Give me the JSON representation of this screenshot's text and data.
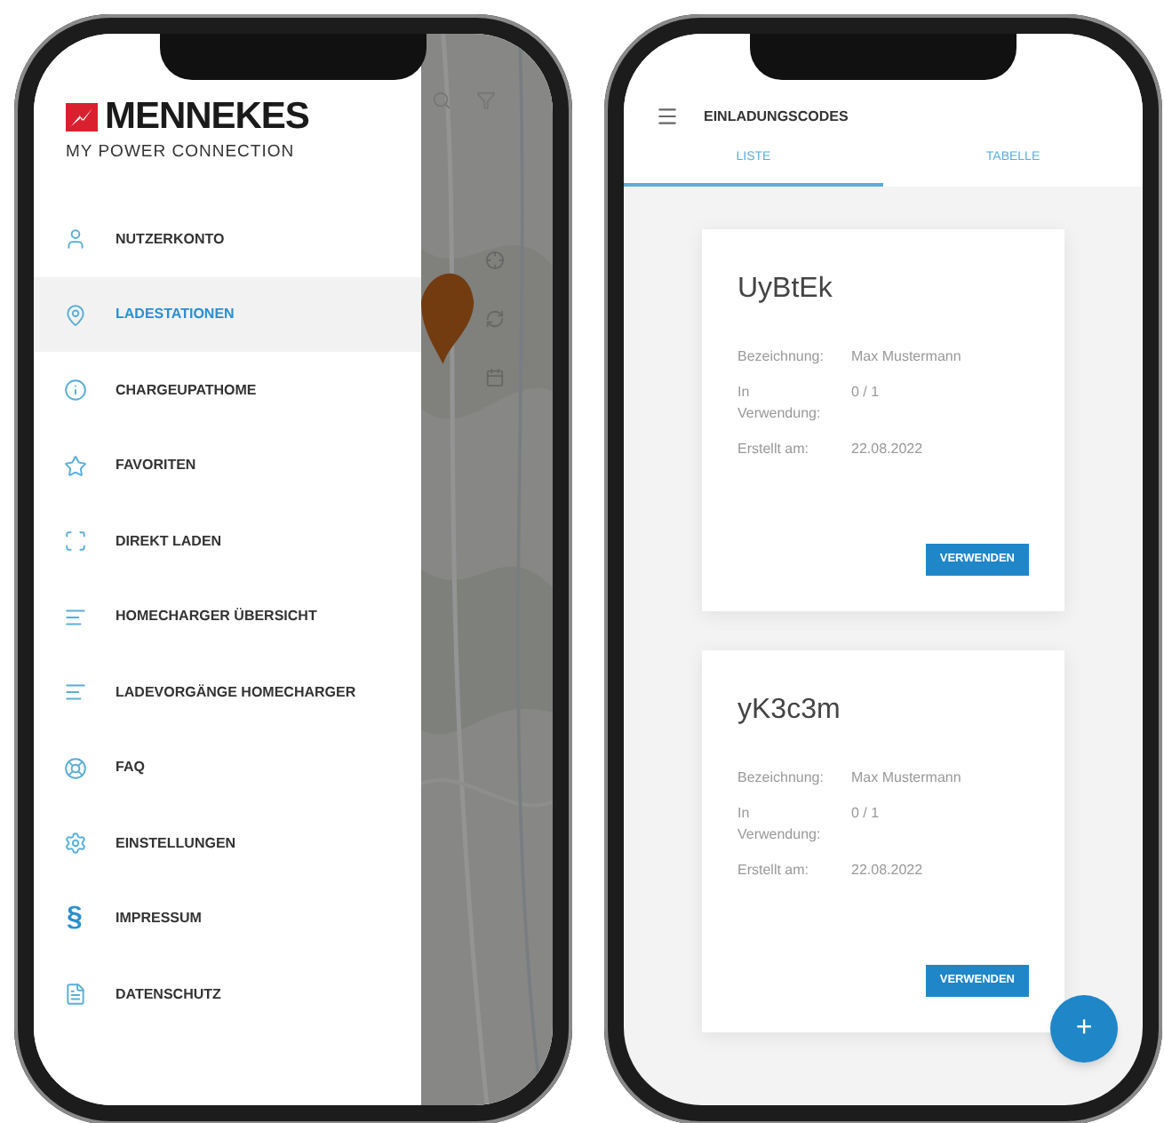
{
  "drawer": {
    "logo": {
      "brand": "MENNEKES",
      "tagline": "MY POWER CONNECTION"
    },
    "items": [
      {
        "label": "NUTZERKONTO",
        "selected": false
      },
      {
        "label": "LADESTATIONEN",
        "selected": true
      },
      {
        "label": "CHARGEUPATHOME",
        "selected": false
      },
      {
        "label": "FAVORITEN",
        "selected": false
      },
      {
        "label": "DIREKT LADEN",
        "selected": false
      },
      {
        "label": "HOMECHARGER ÜBERSICHT",
        "selected": false
      },
      {
        "label": "LADEVORGÄNGE HOMECHARGER",
        "selected": false
      },
      {
        "label": "FAQ",
        "selected": false
      },
      {
        "label": "EINSTELLUNGEN",
        "selected": false
      },
      {
        "label": "IMPRESSUM",
        "icon_char": "§",
        "selected": false
      },
      {
        "label": "DATENSCHUTZ",
        "selected": false
      }
    ]
  },
  "invite_screen": {
    "title": "EINLADUNGSCODES",
    "tabs": [
      {
        "label": "LISTE",
        "selected": true
      },
      {
        "label": "TABELLE",
        "selected": false
      }
    ],
    "cards": [
      {
        "code": "UyBtEk",
        "fields": [
          {
            "label": "Bezeichnung:",
            "value": "Max Mustermann"
          },
          {
            "label": "In Verwendung:",
            "value": "0 / 1"
          },
          {
            "label": "Erstellt am:",
            "value": "22.08.2022"
          }
        ],
        "button": "VERWENDEN"
      },
      {
        "code": "yK3c3m",
        "fields": [
          {
            "label": "Bezeichnung:",
            "value": "Max Mustermann"
          },
          {
            "label": "In Verwendung:",
            "value": "0 / 1"
          },
          {
            "label": "Erstellt am:",
            "value": "22.08.2022"
          }
        ],
        "button": "VERWENDEN"
      }
    ],
    "fab": "+"
  }
}
